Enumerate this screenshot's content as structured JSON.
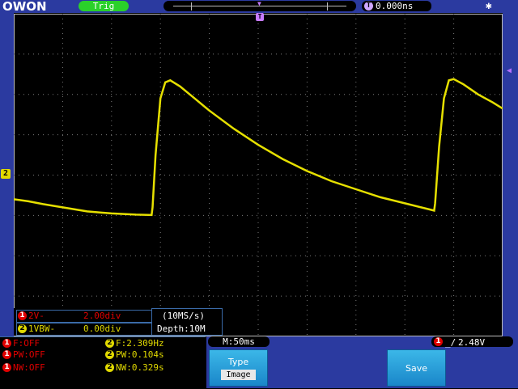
{
  "brand": "OWON",
  "topbar": {
    "trig_status": "Trig",
    "trigger_time": "0.000ns"
  },
  "channel_marks": {
    "ch2": "2",
    "trigger_top": "T"
  },
  "measure_overlay": {
    "row1_label": "2V-",
    "row1_value": "2.00div",
    "row2_label": "1VBW-",
    "row2_value": "0.00div",
    "rate": "(10MS/s)",
    "depth": "Depth:10M",
    "row1_badge": "1",
    "row2_badge": "2"
  },
  "stats": {
    "ch1": [
      {
        "badge": "1",
        "text": "F:OFF"
      },
      {
        "badge": "1",
        "text": "PW:OFF"
      },
      {
        "badge": "1",
        "text": "NW:OFF"
      }
    ],
    "ch2": [
      {
        "badge": "2",
        "text": "F:2.309Hz"
      },
      {
        "badge": "2",
        "text": "PW:0.104s"
      },
      {
        "badge": "2",
        "text": "NW:0.329s"
      }
    ]
  },
  "timebase": "M:50ms",
  "trigger_level": {
    "badge": "1",
    "value": "2.48V"
  },
  "softkeys": [
    {
      "label": "Type",
      "value": "Image"
    },
    {
      "label": "Save",
      "value": ""
    }
  ],
  "colors": {
    "ch1": "#e00000",
    "ch2": "#e0d900",
    "trig": "#2ad12a",
    "panel": "#2b3aa0",
    "softkey": "#1a86c9"
  },
  "waveform": {
    "channel": "2",
    "period_ms": 433,
    "samples_div": [
      [
        0.0,
        4.6
      ],
      [
        0.3,
        4.65
      ],
      [
        0.6,
        4.72
      ],
      [
        1.0,
        4.8
      ],
      [
        1.5,
        4.9
      ],
      [
        2.0,
        4.95
      ],
      [
        2.5,
        4.98
      ],
      [
        2.82,
        4.99
      ],
      [
        2.84,
        4.8
      ],
      [
        2.9,
        3.5
      ],
      [
        3.0,
        2.1
      ],
      [
        3.1,
        1.7
      ],
      [
        3.2,
        1.65
      ],
      [
        3.4,
        1.8
      ],
      [
        3.7,
        2.1
      ],
      [
        4.0,
        2.4
      ],
      [
        4.5,
        2.85
      ],
      [
        5.0,
        3.25
      ],
      [
        5.5,
        3.6
      ],
      [
        6.0,
        3.9
      ],
      [
        6.5,
        4.15
      ],
      [
        7.0,
        4.35
      ],
      [
        7.5,
        4.55
      ],
      [
        8.0,
        4.7
      ],
      [
        8.5,
        4.85
      ],
      [
        8.6,
        4.88
      ],
      [
        8.62,
        4.7
      ],
      [
        8.7,
        3.3
      ],
      [
        8.8,
        2.1
      ],
      [
        8.9,
        1.65
      ],
      [
        9.0,
        1.62
      ],
      [
        9.2,
        1.75
      ],
      [
        9.5,
        2.0
      ],
      [
        9.8,
        2.2
      ],
      [
        10.0,
        2.35
      ]
    ]
  }
}
